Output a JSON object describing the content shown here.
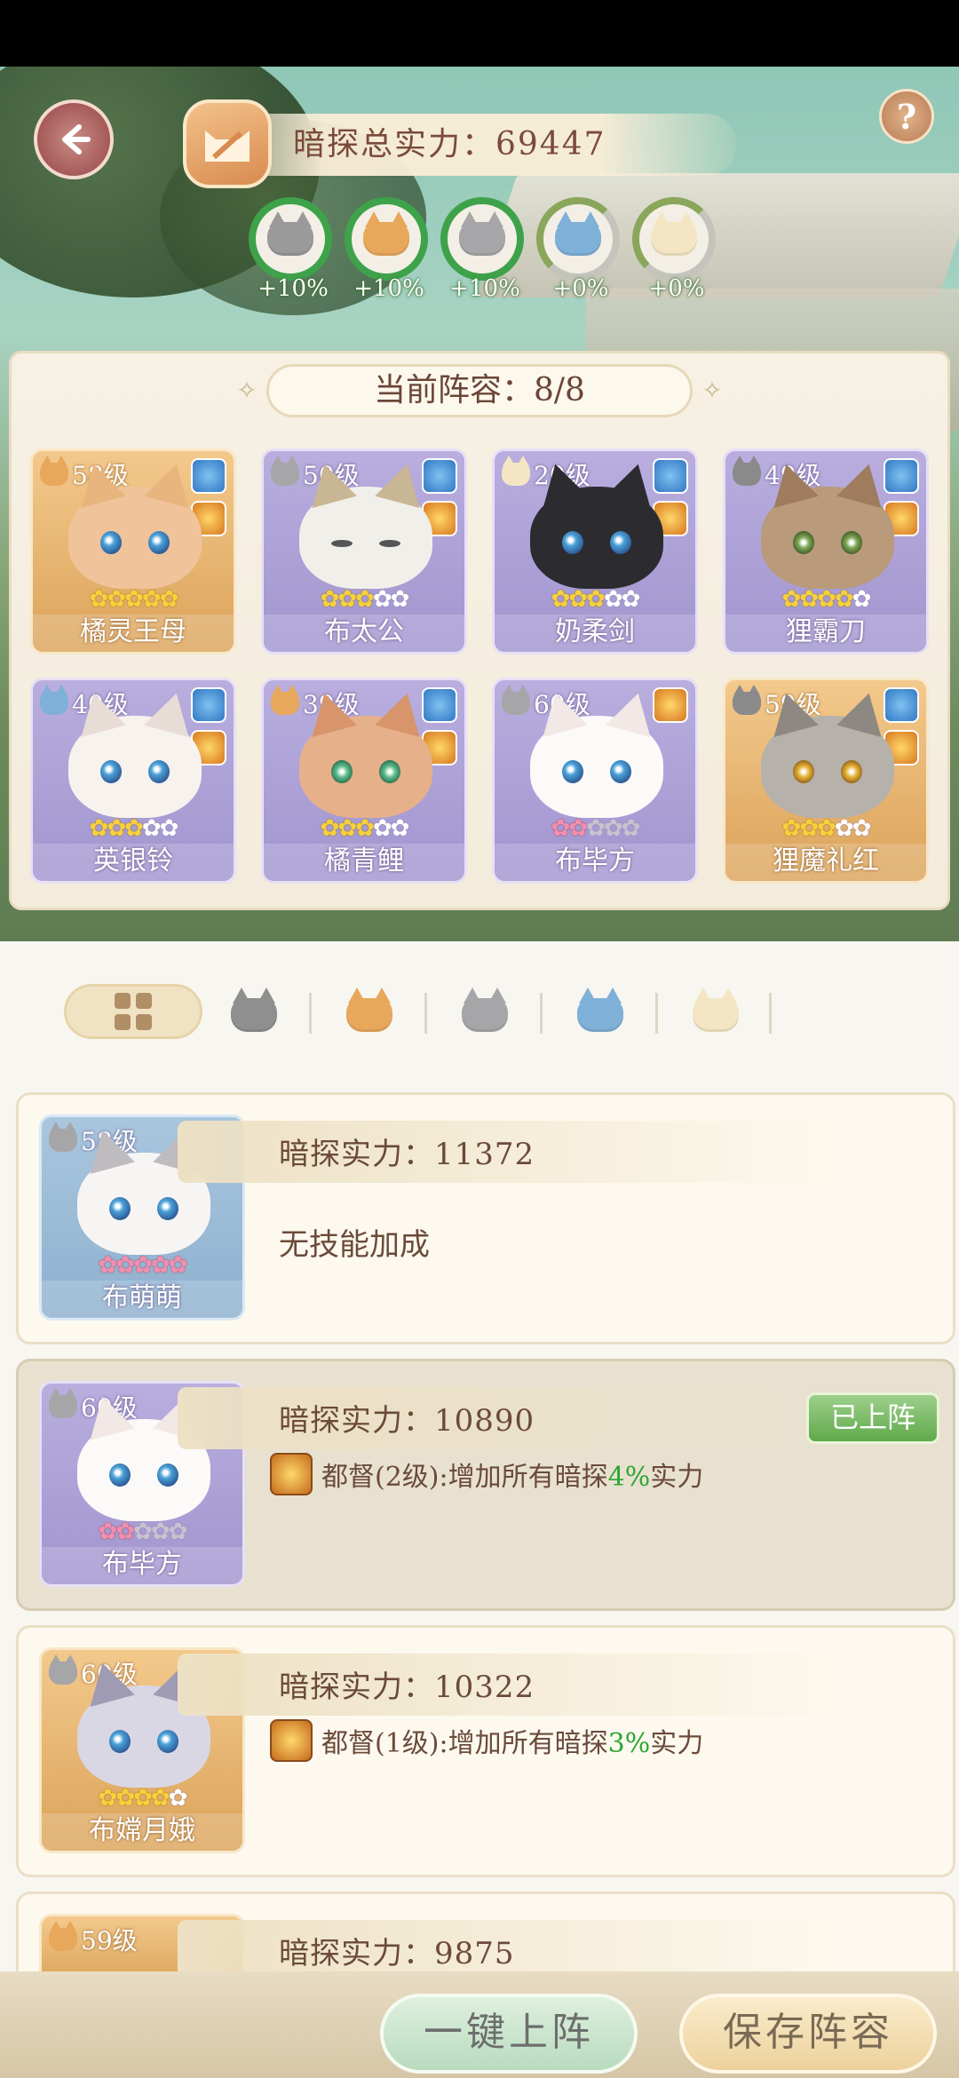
{
  "header": {
    "power_label": "暗探总实力：69447",
    "help_label": "?"
  },
  "bonuses": [
    {
      "label": "+10%",
      "cat_color": "#9a9a9a",
      "full": true
    },
    {
      "label": "+10%",
      "cat_color": "#e8a85c",
      "full": true
    },
    {
      "label": "+10%",
      "cat_color": "#a6a6a8",
      "full": true
    },
    {
      "label": "+0%",
      "cat_color": "#7fb0d8",
      "full": false
    },
    {
      "label": "+0%",
      "cat_color": "#f4e6c4",
      "full": false
    }
  ],
  "lineup": {
    "title": "当前阵容：8/8",
    "cards": [
      {
        "level": "58级",
        "name": "橘灵王母",
        "style": "gold",
        "stars": "5",
        "face": "#f0c39a",
        "ear": "#e9b57f",
        "cat": "#e8a85c"
      },
      {
        "level": "50级",
        "name": "布太公",
        "style": "purple",
        "stars": "3",
        "face": "#f1efea",
        "ear": "#c9b694",
        "cat": "#a6a6a8"
      },
      {
        "level": "20级",
        "name": "奶柔剑",
        "style": "purple",
        "stars": "3",
        "face": "#2b2b30",
        "ear": "#2b2b30",
        "cat": "#f4e6c4"
      },
      {
        "level": "49级",
        "name": "狸霸刀",
        "style": "purple",
        "stars": "4",
        "face": "#b99a7a",
        "ear": "#9e7c5d",
        "cat": "#8a8a8a"
      },
      {
        "level": "40级",
        "name": "英银铃",
        "style": "purple",
        "stars": "3",
        "face": "#f7f2ee",
        "ear": "#e8dcd6",
        "cat": "#7fb0d8"
      },
      {
        "level": "39级",
        "name": "橘青鲤",
        "style": "purple",
        "stars": "3",
        "face": "#e6b08a",
        "ear": "#d8946a",
        "cat": "#e8a85c"
      },
      {
        "level": "60级",
        "name": "布毕方",
        "style": "purple",
        "stars": "pink2",
        "face": "#fbfaf8",
        "ear": "#f2e9e6",
        "cat": "#a6a6a8"
      },
      {
        "level": "59级",
        "name": "狸魔礼红",
        "style": "gold",
        "stars": "3",
        "face": "#b6b1ab",
        "ear": "#8d8881",
        "cat": "#8a8a8a"
      }
    ]
  },
  "filter_tabs": [
    {
      "name": "all"
    },
    {
      "cat_color": "#8f8f8f"
    },
    {
      "cat_color": "#e8a85c"
    },
    {
      "cat_color": "#a6a6a8"
    },
    {
      "cat_color": "#7fb0d8"
    },
    {
      "cat_color": "#f4e6c4"
    }
  ],
  "roster": [
    {
      "level": "58级",
      "name": "布萌萌",
      "power": "暗探实力：11372",
      "skill": "无技能加成",
      "style": "blue"
    },
    {
      "level": "60级",
      "name": "布毕方",
      "power": "暗探实力：10890",
      "skill_pre": "都督(2级):增加所有暗探",
      "skill_hl": "4%",
      "skill_post": "实力",
      "deployed": "已上阵",
      "style": "purple"
    },
    {
      "level": "60级",
      "name": "布嫦月娥",
      "power": "暗探实力：10322",
      "skill_pre": "都督(1级):增加所有暗探",
      "skill_hl": "3%",
      "skill_post": "实力",
      "style": "gold"
    },
    {
      "level": "59级",
      "name": "",
      "power": "暗探实力：9875",
      "style": "gold"
    }
  ],
  "footer": {
    "deploy_all": "一键上阵",
    "save_lineup": "保存阵容"
  }
}
